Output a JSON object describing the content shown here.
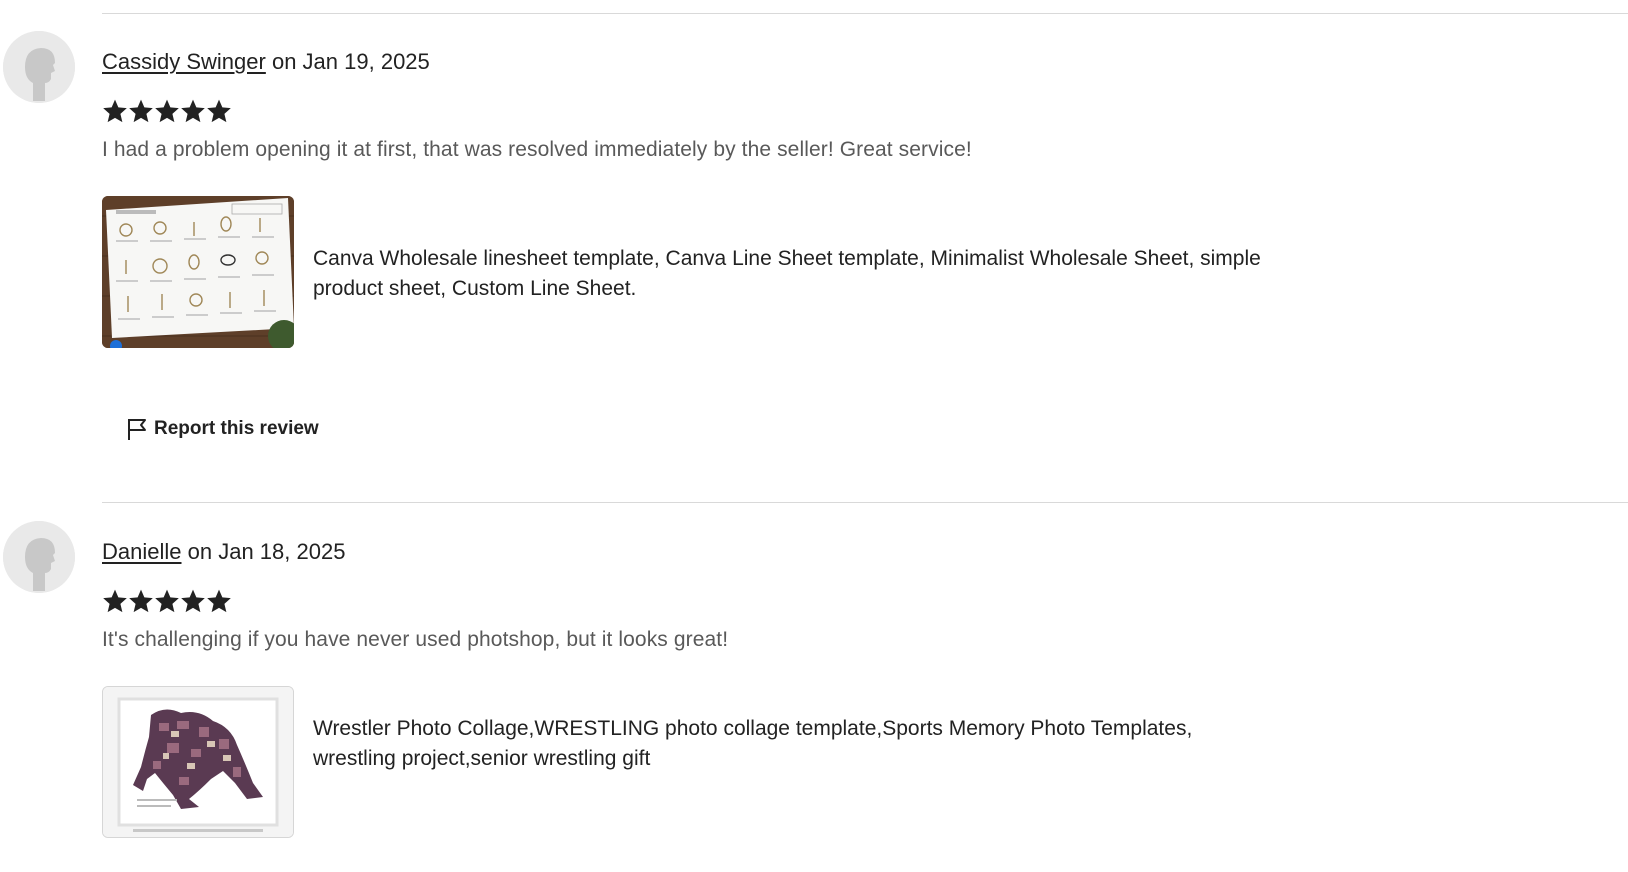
{
  "reviews": [
    {
      "reviewer": "Cassidy Swinger",
      "date_text": "on Jan 19, 2025",
      "rating": 5,
      "text": "I had a problem opening it at first, that was resolved immediately by the seller! Great service!",
      "listing_title": "Canva Wholesale linesheet template, Canva Line Sheet template, Minimalist Wholesale Sheet, simple product sheet, Custom Line Sheet.",
      "report_label": "Report this review"
    },
    {
      "reviewer": "Danielle",
      "date_text": "on Jan 18, 2025",
      "rating": 5,
      "text": "It's challenging if you have never used photshop, but it looks great!",
      "listing_title": "Wrestler Photo Collage,WRESTLING photo collage template,Sports Memory Photo Templates, wrestling project,senior wrestling gift"
    }
  ],
  "colors": {
    "star": "#222222",
    "divider": "#d9d9d9",
    "review_text": "#595959",
    "avatar_bg": "#e9e9e9"
  }
}
